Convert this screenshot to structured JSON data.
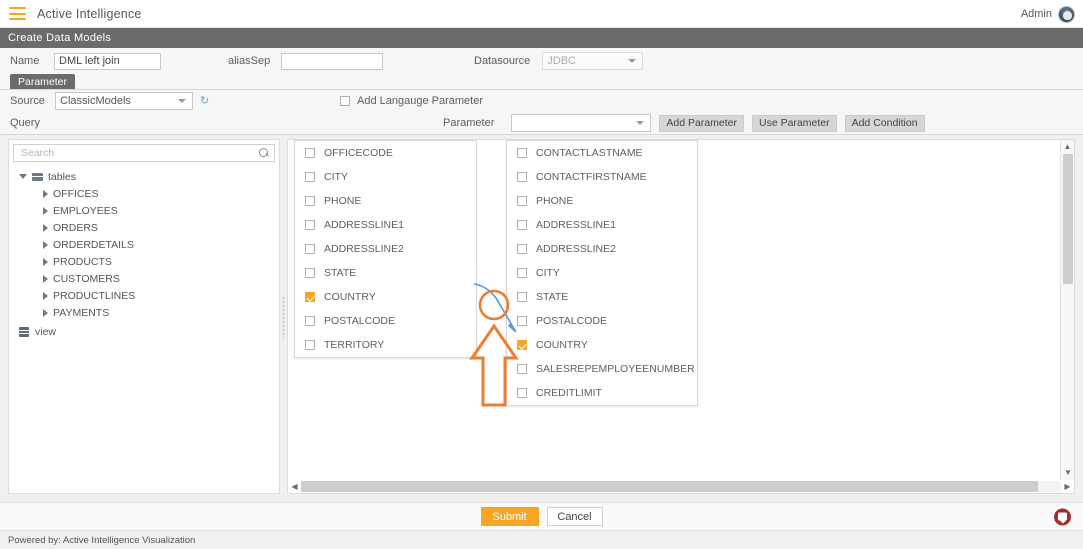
{
  "topbar": {
    "menu_icon": "hamburger-icon",
    "app_title": "Active Intelligence",
    "user_label": "Admin",
    "avatar_icon": "user-avatar-icon"
  },
  "section": {
    "title": "Create Data Models"
  },
  "form": {
    "name_label": "Name",
    "name_value": "DML left join",
    "alias_label": "aliasSep",
    "alias_value": "",
    "alias_placeholder": "",
    "datasource_label": "Datasource",
    "datasource_value": "JDBC"
  },
  "tab": {
    "label": "Parameter"
  },
  "parameter_panel": {
    "source_label": "Source",
    "source_value": "ClassicModels",
    "refresh_icon": "refresh-icon",
    "add_language_label": "Add Langauge Parameter",
    "add_language_checked": false,
    "query_label": "Query",
    "parameter_label": "Parameter",
    "parameter_value": "",
    "buttons": [
      {
        "label": "Add Parameter",
        "name": "add-parameter-button"
      },
      {
        "label": "Use Parameter",
        "name": "use-parameter-button"
      },
      {
        "label": "Add Condition",
        "name": "add-condition-button"
      }
    ]
  },
  "tree_panel": {
    "search_placeholder": "Search",
    "search_value": "",
    "search_icon": "search-icon",
    "root": {
      "label": "tables",
      "icon": "table-icon",
      "expanded": true
    },
    "tables": [
      "OFFICES",
      "EMPLOYEES",
      "ORDERS",
      "ORDERDETAILS",
      "PRODUCTS",
      "CUSTOMERS",
      "PRODUCTLINES",
      "PAYMENTS"
    ],
    "view": {
      "label": "view",
      "icon": "view-icon"
    }
  },
  "column_lists": [
    {
      "name": "offices-column-list",
      "columns": [
        {
          "label": "OFFICECODE",
          "checked": false
        },
        {
          "label": "CITY",
          "checked": false
        },
        {
          "label": "PHONE",
          "checked": false
        },
        {
          "label": "ADDRESSLINE1",
          "checked": false
        },
        {
          "label": "ADDRESSLINE2",
          "checked": false
        },
        {
          "label": "STATE",
          "checked": false
        },
        {
          "label": "COUNTRY",
          "checked": true
        },
        {
          "label": "POSTALCODE",
          "checked": false
        },
        {
          "label": "TERRITORY",
          "checked": false
        }
      ]
    },
    {
      "name": "customers-column-list",
      "columns": [
        {
          "label": "CONTACTLASTNAME",
          "checked": false
        },
        {
          "label": "CONTACTFIRSTNAME",
          "checked": false
        },
        {
          "label": "PHONE",
          "checked": false
        },
        {
          "label": "ADDRESSLINE1",
          "checked": false
        },
        {
          "label": "ADDRESSLINE2",
          "checked": false
        },
        {
          "label": "CITY",
          "checked": false
        },
        {
          "label": "STATE",
          "checked": false
        },
        {
          "label": "POSTALCODE",
          "checked": false
        },
        {
          "label": "COUNTRY",
          "checked": true
        },
        {
          "label": "SALESREPEMPLOYEENUMBER",
          "checked": false
        },
        {
          "label": "CREDITLIMIT",
          "checked": false
        }
      ]
    }
  ],
  "footer": {
    "submit_label": "Submit",
    "cancel_label": "Cancel",
    "chat_icon": "chat-bubble-icon",
    "powered_by": "Powered by: Active Intelligence Visualization"
  },
  "annotations": {
    "circle_color": "#ED7D31",
    "arrow_color": "#ED7D31",
    "pointer_color": "#5B9BD5"
  },
  "colors": {
    "accent": "#f5a623",
    "header_bar": "#6b6b6b",
    "annotation_orange": "#ED7D31",
    "pointer_blue": "#5B9BD5",
    "chat_red": "#a03030"
  }
}
